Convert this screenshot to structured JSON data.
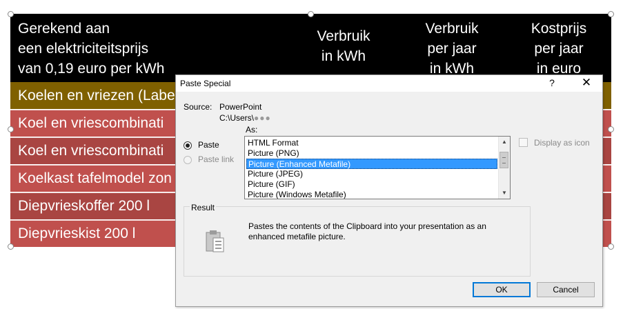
{
  "table": {
    "header": {
      "col0_lines": [
        "Gerekend aan",
        "een elektriciteitsprijs",
        "van 0,19 euro per kWh"
      ],
      "col1_lines": [
        "Verbruik",
        "in kWh"
      ],
      "col2_lines": [
        "Verbruik",
        "per jaar",
        "in kWh"
      ],
      "col3_lines": [
        "Kostprijs",
        "per jaar",
        "in euro"
      ]
    },
    "rows": [
      "Koelen en vriezen (Labe",
      "Koel en vriescombinati",
      "Koel en vriescombinati",
      "Koelkast tafelmodel zon",
      "Diepvrieskoffer 200 l",
      "Diepvrieskist 200 l"
    ]
  },
  "dialog": {
    "title": "Paste Special",
    "help_symbol": "?",
    "close_symbol": "✕",
    "source_label": "Source:",
    "source_app": "PowerPoint",
    "source_path": "C:\\Users\\",
    "as_label": "As:",
    "options": {
      "paste": {
        "label": "Paste",
        "checked": true
      },
      "paste_link": {
        "label": "Paste link",
        "enabled": false
      }
    },
    "formats": [
      "HTML Format",
      "Picture (PNG)",
      "Picture (Enhanced Metafile)",
      "Picture (JPEG)",
      "Picture (GIF)",
      "Picture (Windows Metafile)"
    ],
    "selected_format": "Picture (Enhanced Metafile)",
    "display_as_icon_label": "Display as icon",
    "result_label": "Result",
    "result_text": "Pastes the contents of the Clipboard into your presentation as an enhanced metafile picture.",
    "ok_label": "OK",
    "cancel_label": "Cancel"
  },
  "colors": {
    "header_bg": "#000000",
    "row_gold": "#7f6000",
    "row_red": "#c0504d",
    "row_red_dark": "#a94542",
    "selection": "#3399ff",
    "focus": "#0078d7"
  },
  "icons": {
    "result": "clipboard-paste-icon",
    "scroll_up": "scroll-up-arrow-icon",
    "scroll_down": "scroll-down-arrow-icon",
    "close": "close-icon",
    "help": "help-icon"
  }
}
